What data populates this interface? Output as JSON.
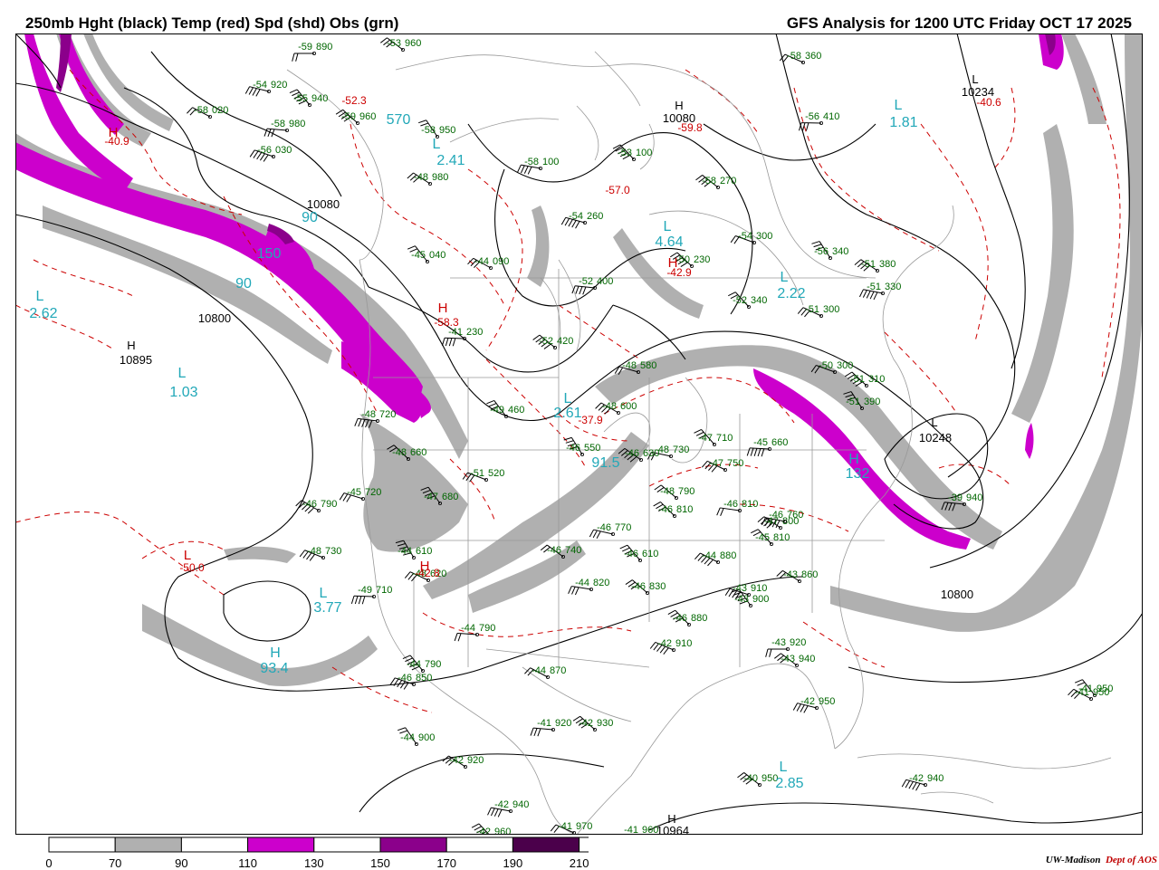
{
  "header": {
    "title_left": "250mb Hght (black) Temp (red) Spd (shd) Obs (grn)",
    "title_right": "GFS Analysis for 1200 UTC Friday  OCT 17 2025"
  },
  "colors": {
    "height": "#000000",
    "temperature": "#cc0000",
    "obs": "#006600",
    "speed_labels": "#22a8b8",
    "shade_70_90": "#b0b0b0",
    "shade_110_130": "#cc00cc",
    "shade_150_170": "#8b008b",
    "shade_190_210": "#4b004b"
  },
  "colorbar": {
    "labels": [
      "0",
      "70",
      "90",
      "110",
      "130",
      "150",
      "170",
      "190",
      "210"
    ],
    "fills": [
      "#ffffff",
      "#b0b0b0",
      "#ffffff",
      "#cc00cc",
      "#ffffff",
      "#8b008b",
      "#ffffff",
      "#4b004b",
      "#ffffff"
    ]
  },
  "credit": {
    "a": "UW-Madison",
    "b": "Dept of AOS"
  },
  "height_labels": [
    {
      "text": "10895",
      "kind": "H"
    },
    {
      "text": "10800",
      "kind": "plain"
    },
    {
      "text": "10800",
      "kind": "plain"
    },
    {
      "text": "10080",
      "kind": "plain"
    },
    {
      "text": "10080",
      "kind": "H"
    },
    {
      "text": "10234",
      "kind": "L"
    },
    {
      "text": "10248",
      "kind": "L"
    },
    {
      "text": "10800",
      "kind": "plain"
    },
    {
      "text": "10964",
      "kind": "H"
    }
  ],
  "temp_labels": [
    {
      "text": "-40.9"
    },
    {
      "text": "-59.8"
    },
    {
      "text": "-40.6"
    },
    {
      "text": "-57.0"
    },
    {
      "text": "-42.9"
    },
    {
      "text": "-58.3"
    },
    {
      "text": "-37.9"
    },
    {
      "text": "-50.0"
    },
    {
      "text": "-42.8"
    }
  ],
  "speed_labels": [
    {
      "text": "2.62",
      "kind": "L"
    },
    {
      "text": "1.03",
      "kind": "L"
    },
    {
      "text": "1.81",
      "kind": "L"
    },
    {
      "text": "2.22",
      "kind": "L"
    },
    {
      "text": "4.64",
      "kind": "L"
    },
    {
      "text": "3.77",
      "kind": "L"
    },
    {
      "text": "93.4",
      "kind": "H"
    },
    {
      "text": "132",
      "kind": "H"
    },
    {
      "text": "91.5",
      "kind": "plain"
    },
    {
      "text": "2.85",
      "kind": "L"
    },
    {
      "text": "2.41",
      "kind": "L"
    },
    {
      "text": "2.61",
      "kind": "L"
    }
  ],
  "obs": [
    {
      "t": "-59",
      "h": "890"
    },
    {
      "t": "-53",
      "h": "960"
    },
    {
      "t": "-54",
      "h": "920"
    },
    {
      "t": "-55",
      "h": "940"
    },
    {
      "t": "-58",
      "h": "020"
    },
    {
      "t": "-58",
      "h": "980"
    },
    {
      "t": "-59",
      "h": "960"
    },
    {
      "t": "-56",
      "h": "030"
    },
    {
      "t": "-58",
      "h": "950"
    },
    {
      "t": "-48",
      "h": "980"
    },
    {
      "t": "-58",
      "h": "100"
    },
    {
      "t": "-53",
      "h": "100"
    },
    {
      "t": "-58",
      "h": "360"
    },
    {
      "t": "-56",
      "h": "410"
    },
    {
      "t": "-58",
      "h": "270"
    },
    {
      "t": "-54",
      "h": "260"
    },
    {
      "t": "-45",
      "h": "040"
    },
    {
      "t": "-44",
      "h": "090"
    },
    {
      "t": "-52",
      "h": "400"
    },
    {
      "t": "-50",
      "h": "230"
    },
    {
      "t": "-54",
      "h": "300"
    },
    {
      "t": "-56",
      "h": "340"
    },
    {
      "t": "-51",
      "h": "380"
    },
    {
      "t": "-51",
      "h": "330"
    },
    {
      "t": "-52",
      "h": "340"
    },
    {
      "t": "-51",
      "h": "300"
    },
    {
      "t": "-41",
      "h": "230"
    },
    {
      "t": "-52",
      "h": "420"
    },
    {
      "t": "-48",
      "h": "580"
    },
    {
      "t": "-49",
      "h": "460"
    },
    {
      "t": "-48",
      "h": "600"
    },
    {
      "t": "-48",
      "h": "720"
    },
    {
      "t": "-48",
      "h": "660"
    },
    {
      "t": "-51",
      "h": "520"
    },
    {
      "t": "-46",
      "h": "550"
    },
    {
      "t": "-46",
      "h": "630"
    },
    {
      "t": "-48",
      "h": "730"
    },
    {
      "t": "-47",
      "h": "710"
    },
    {
      "t": "-47",
      "h": "750"
    },
    {
      "t": "-45",
      "h": "660"
    },
    {
      "t": "-48",
      "h": "790"
    },
    {
      "t": "-45",
      "h": "720"
    },
    {
      "t": "-47",
      "h": "680"
    },
    {
      "t": "-46",
      "h": "790"
    },
    {
      "t": "-46",
      "h": "810"
    },
    {
      "t": "-46",
      "h": "810"
    },
    {
      "t": "-48",
      "h": "730"
    },
    {
      "t": "-44",
      "h": "610"
    },
    {
      "t": "-46",
      "h": "740"
    },
    {
      "t": "-46",
      "h": "770"
    },
    {
      "t": "-46",
      "h": "610"
    },
    {
      "t": "-44",
      "h": "880"
    },
    {
      "t": "-44",
      "h": "790"
    },
    {
      "t": "-46",
      "h": "830"
    },
    {
      "t": "-43",
      "h": "910"
    },
    {
      "t": "-43",
      "h": "900"
    },
    {
      "t": "-43",
      "h": "860"
    },
    {
      "t": "-44",
      "h": "820"
    },
    {
      "t": "-46",
      "h": "880"
    },
    {
      "t": "-42",
      "h": "910"
    },
    {
      "t": "-43",
      "h": "920"
    },
    {
      "t": "-43",
      "h": "940"
    },
    {
      "t": "-42",
      "h": "950"
    },
    {
      "t": "-44",
      "h": "790"
    },
    {
      "t": "-44",
      "h": "870"
    },
    {
      "t": "-41",
      "h": "920"
    },
    {
      "t": "-42",
      "h": "930"
    },
    {
      "t": "-46",
      "h": "850"
    },
    {
      "t": "-44",
      "h": "900"
    },
    {
      "t": "-42",
      "h": "920"
    },
    {
      "t": "-42",
      "h": "940"
    },
    {
      "t": "-42",
      "h": "960"
    },
    {
      "t": "-41",
      "h": "970"
    },
    {
      "t": "-41",
      "h": "960"
    },
    {
      "t": "-40",
      "h": "950"
    },
    {
      "t": "-42",
      "h": "940"
    },
    {
      "t": "-41",
      "h": "950"
    },
    {
      "t": "-41",
      "h": "950"
    },
    {
      "t": "-39",
      "h": "940"
    },
    {
      "t": "-51",
      "h": "310"
    },
    {
      "t": "-50",
      "h": "300"
    },
    {
      "t": "-51",
      "h": "390"
    },
    {
      "t": "-47",
      "h": "800"
    },
    {
      "t": "-46",
      "h": "760"
    },
    {
      "t": "-45",
      "h": "810"
    },
    {
      "t": "-48",
      "h": "620"
    },
    {
      "t": "-49",
      "h": "710"
    }
  ]
}
